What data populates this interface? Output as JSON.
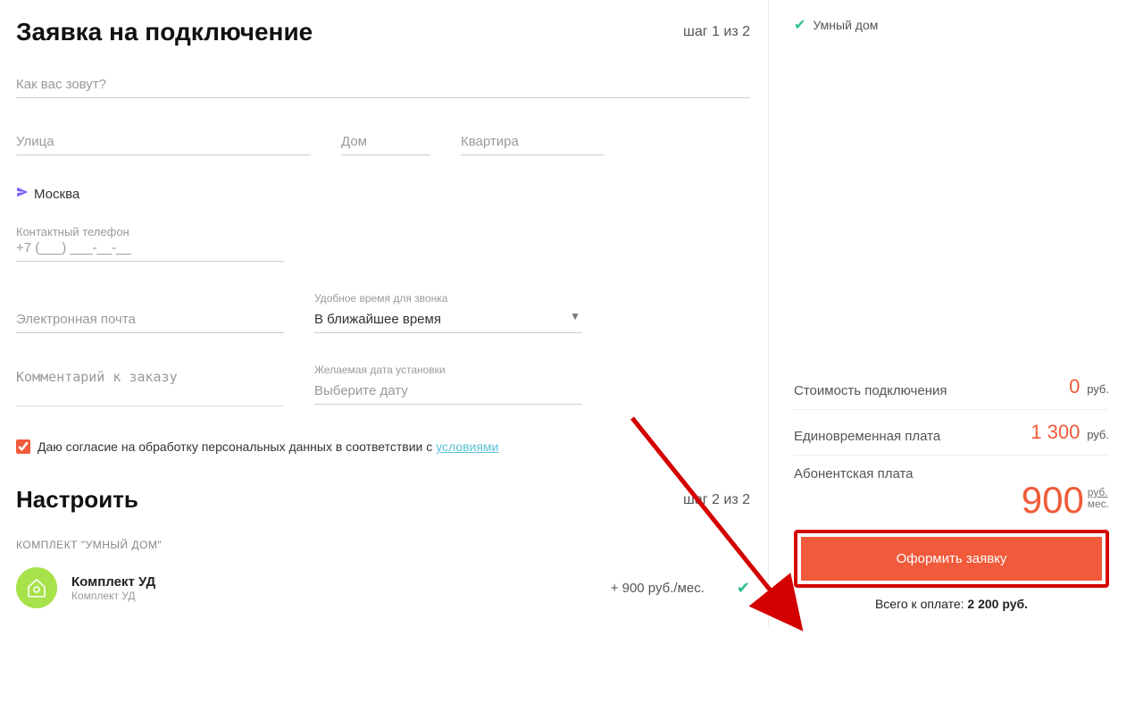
{
  "form": {
    "title": "Заявка на подключение",
    "step_label": "шаг 1 из 2",
    "name_placeholder": "Как вас зовут?",
    "street_placeholder": "Улица",
    "house_placeholder": "Дом",
    "apt_placeholder": "Квартира",
    "city": "Москва",
    "phone_label": "Контактный телефон",
    "phone_mask": "+7 (___) ___-__-__",
    "email_placeholder": "Электронная почта",
    "calltime_label": "Удобное время для звонка",
    "calltime_value": "В ближайшее время",
    "comment_placeholder": "Комментарий к заказу",
    "install_date_label": "Желаемая дата установки",
    "install_date_placeholder": "Выберите дату",
    "consent_text": "Даю согласие на обработку персональных данных в соответствии с ",
    "consent_link": "условиями"
  },
  "configure": {
    "title": "Настроить",
    "step_label": "шаг 2 из 2",
    "kit_section_label": "КОМПЛЕКТ \"УМНЫЙ ДОМ\"",
    "kit_title": "Комплект УД",
    "kit_sub": "Комплект УД",
    "kit_price": "+ 900 руб./мес."
  },
  "summary": {
    "item1": "Умный дом",
    "connect_label": "Стоимость подключения",
    "connect_value": "0",
    "connect_unit": "руб.",
    "onetime_label": "Единовременная плата",
    "onetime_value": "1 300",
    "onetime_unit": "руб.",
    "sub_label": "Абонентская плата",
    "sub_value": "900",
    "sub_unit_top": "руб.",
    "sub_unit_bottom": "мес.",
    "submit_label": "Оформить заявку",
    "total_prefix": "Всего к оплате: ",
    "total_value": "2 200 руб."
  }
}
